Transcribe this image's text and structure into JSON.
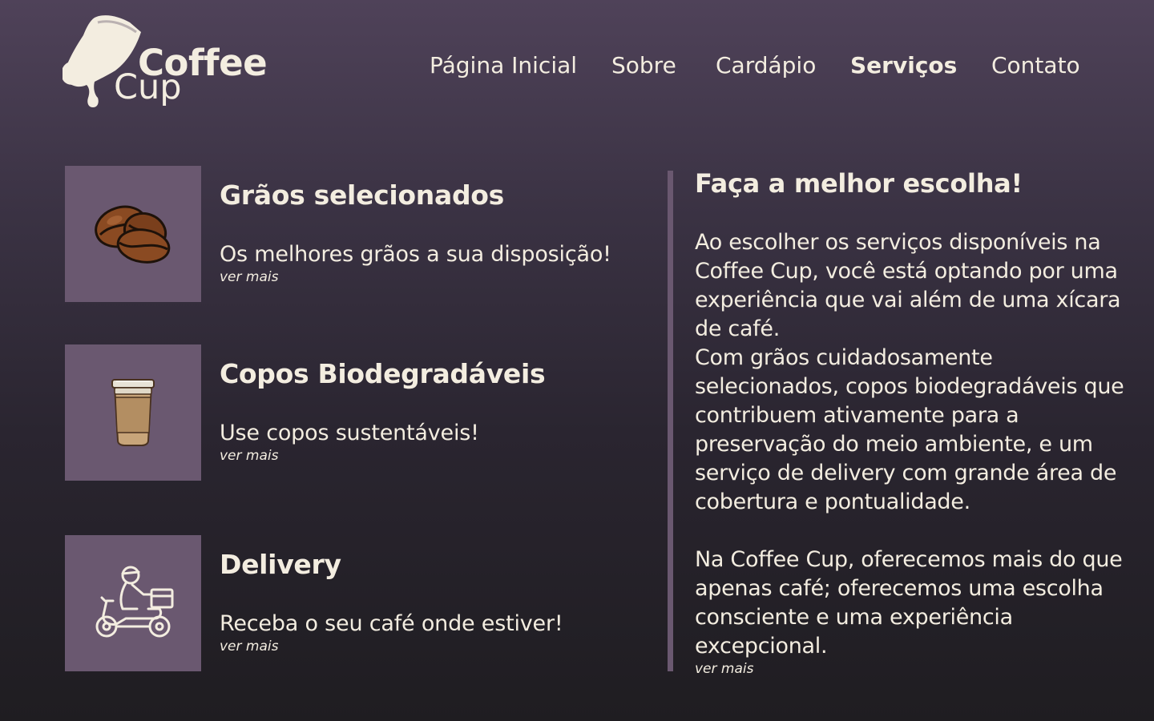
{
  "brand": {
    "line1": "Coffee",
    "line2": "Cup"
  },
  "nav": {
    "items": [
      {
        "label": "Página Inicial",
        "active": false
      },
      {
        "label": "Sobre",
        "active": false
      },
      {
        "label": "Cardápio",
        "active": false
      },
      {
        "label": "Serviços",
        "active": true
      },
      {
        "label": "Contato",
        "active": false
      }
    ]
  },
  "services": [
    {
      "icon": "coffee-beans-icon",
      "title": "Grãos selecionados",
      "description": "Os melhores grãos a sua disposição!",
      "link": "ver mais"
    },
    {
      "icon": "biodegradable-cup-icon",
      "title": "Copos Biodegradáveis",
      "description": "Use copos sustentáveis!",
      "link": "ver mais"
    },
    {
      "icon": "delivery-scooter-icon",
      "title": "Delivery",
      "description": "Receba o seu café onde estiver!",
      "link": "ver mais"
    }
  ],
  "aside": {
    "title": "Faça a melhor escolha!",
    "body": "Ao escolher os serviços disponíveis na Coffee Cup, você está optando por uma experiência que vai além de uma xícara de café.\nCom grãos cuidadosamente selecionados, copos biodegradáveis que contribuem ativamente para a preservação do meio ambiente, e um serviço de delivery com grande área de cobertura e pontualidade.\n\nNa Coffee Cup, oferecemos mais do que apenas café; oferecemos uma escolha consciente e uma experiência excepcional.",
    "link": "ver mais"
  },
  "colors": {
    "text": "#f3ede0",
    "card": "#6a5870",
    "background_top": "#4f4259",
    "background_bottom": "#1f1d21"
  }
}
